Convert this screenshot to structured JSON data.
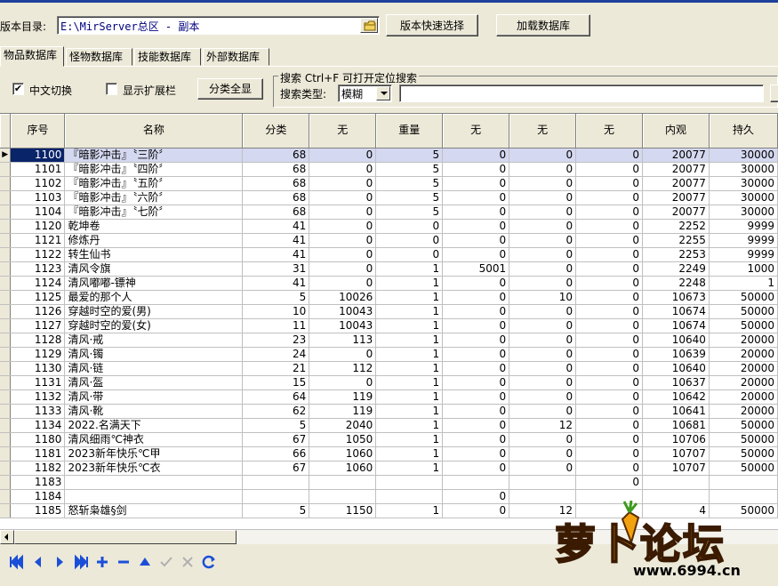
{
  "toolbar": {
    "dir_label": "版本目录:",
    "dir_value": "E:\\MirServer总区 - 副本",
    "quick_select_label": "版本快速选择",
    "load_db_label": "加载数据库"
  },
  "tabs": [
    "物品数据库",
    "怪物数据库",
    "技能数据库",
    "外部数据库"
  ],
  "options": {
    "chinese_toggle_label": "中文切换",
    "chinese_toggle_checked": true,
    "show_ext_label": "显示扩展栏",
    "show_ext_checked": false,
    "show_all_label": "分类全显"
  },
  "search": {
    "group_title": "搜索  Ctrl+F 可打开定位搜索",
    "type_label": "搜索类型:",
    "type_value": "模糊",
    "query_value": ""
  },
  "grid": {
    "columns": [
      "序号",
      "名称",
      "分类",
      "无",
      "重量",
      "无",
      "无",
      "无",
      "内观",
      "持久"
    ],
    "selected_index": 0,
    "rows": [
      [
        "1100",
        "『暗影冲击』〝三阶〞",
        "68",
        "0",
        "5",
        "0",
        "0",
        "0",
        "20077",
        "30000"
      ],
      [
        "1101",
        "『暗影冲击』〝四阶〞",
        "68",
        "0",
        "5",
        "0",
        "0",
        "0",
        "20077",
        "30000"
      ],
      [
        "1102",
        "『暗影冲击』〝五阶〞",
        "68",
        "0",
        "5",
        "0",
        "0",
        "0",
        "20077",
        "30000"
      ],
      [
        "1103",
        "『暗影冲击』〝六阶〞",
        "68",
        "0",
        "5",
        "0",
        "0",
        "0",
        "20077",
        "30000"
      ],
      [
        "1104",
        "『暗影冲击』〝七阶〞",
        "68",
        "0",
        "5",
        "0",
        "0",
        "0",
        "20077",
        "30000"
      ],
      [
        "1120",
        "乾坤卷",
        "41",
        "0",
        "0",
        "0",
        "0",
        "0",
        "2252",
        "9999"
      ],
      [
        "1121",
        "修炼丹",
        "41",
        "0",
        "0",
        "0",
        "0",
        "0",
        "2255",
        "9999"
      ],
      [
        "1122",
        "转生仙书",
        "41",
        "0",
        "0",
        "0",
        "0",
        "0",
        "2253",
        "9999"
      ],
      [
        "1123",
        "清风令旗",
        "31",
        "0",
        "1",
        "5001",
        "0",
        "0",
        "2249",
        "1000"
      ],
      [
        "1124",
        "清风嘟嘟-镖神",
        "41",
        "0",
        "1",
        "0",
        "0",
        "0",
        "2248",
        "1"
      ],
      [
        "1125",
        "最爱的那个人",
        "5",
        "10026",
        "1",
        "0",
        "10",
        "0",
        "10673",
        "50000"
      ],
      [
        "1126",
        "穿越时空的爱(男)",
        "10",
        "10043",
        "1",
        "0",
        "0",
        "0",
        "10674",
        "50000"
      ],
      [
        "1127",
        "穿越时空的爱(女)",
        "11",
        "10043",
        "1",
        "0",
        "0",
        "0",
        "10674",
        "50000"
      ],
      [
        "1128",
        "清风·戒",
        "23",
        "113",
        "1",
        "0",
        "0",
        "0",
        "10640",
        "20000"
      ],
      [
        "1129",
        "清风·镯",
        "24",
        "0",
        "1",
        "0",
        "0",
        "0",
        "10639",
        "20000"
      ],
      [
        "1130",
        "清风·链",
        "21",
        "112",
        "1",
        "0",
        "0",
        "0",
        "10640",
        "20000"
      ],
      [
        "1131",
        "清风·盔",
        "15",
        "0",
        "1",
        "0",
        "0",
        "0",
        "10637",
        "20000"
      ],
      [
        "1132",
        "清风·带",
        "64",
        "119",
        "1",
        "0",
        "0",
        "0",
        "10642",
        "20000"
      ],
      [
        "1133",
        "清风·靴",
        "62",
        "119",
        "1",
        "0",
        "0",
        "0",
        "10641",
        "20000"
      ],
      [
        "1134",
        "2022.名满天下",
        "5",
        "2040",
        "1",
        "0",
        "12",
        "0",
        "10681",
        "50000"
      ],
      [
        "1180",
        "清风细雨℃神衣",
        "67",
        "1050",
        "1",
        "0",
        "0",
        "0",
        "10706",
        "50000"
      ],
      [
        "1181",
        "2023新年快乐℃甲",
        "66",
        "1060",
        "1",
        "0",
        "0",
        "0",
        "10707",
        "50000"
      ],
      [
        "1182",
        "2023新年快乐℃衣",
        "67",
        "1060",
        "1",
        "0",
        "0",
        "0",
        "10707",
        "50000"
      ],
      [
        "1183",
        "",
        "",
        "",
        "",
        "",
        "",
        "0",
        "",
        ""
      ],
      [
        "1184",
        "",
        "",
        "",
        "",
        "0",
        "",
        "",
        "",
        ""
      ],
      [
        "1185",
        "怒斩枭雄§剑",
        "5",
        "1150",
        "1",
        "0",
        "12",
        "",
        "4",
        "50000"
      ]
    ]
  },
  "watermark": {
    "brand": "萝卜论坛",
    "site": "www.6994.cn"
  },
  "colors": {
    "window_bg": "#ece9d8",
    "selection": "#0a246a",
    "nav_icon": "#1c4fd8",
    "logo_orange": "#f2a20f"
  }
}
